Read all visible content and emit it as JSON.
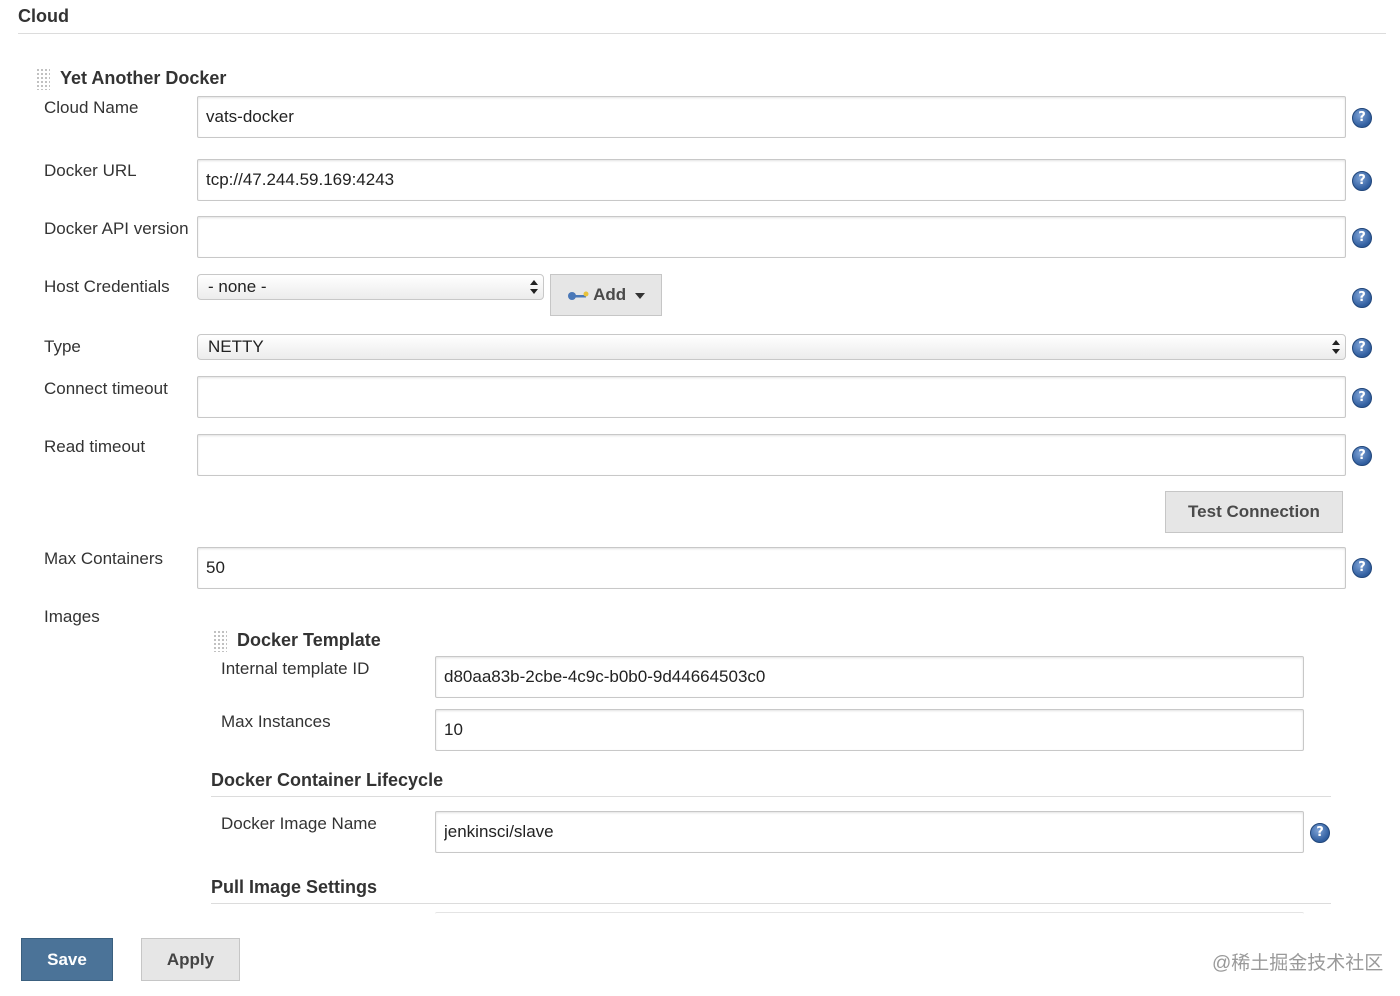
{
  "page": {
    "heading": "Cloud"
  },
  "cloud": {
    "title": "Yet Another Docker",
    "fields": {
      "cloud_name": {
        "label": "Cloud Name",
        "value": "vats-docker"
      },
      "docker_url": {
        "label": "Docker URL",
        "value": "tcp://47.244.59.169:4243"
      },
      "docker_api_version": {
        "label": "Docker API version",
        "value": ""
      },
      "host_credentials": {
        "label": "Host Credentials",
        "selected": "- none -",
        "add_label": "Add"
      },
      "type": {
        "label": "Type",
        "selected": "NETTY"
      },
      "connect_timeout": {
        "label": "Connect timeout",
        "value": ""
      },
      "read_timeout": {
        "label": "Read timeout",
        "value": ""
      },
      "max_containers": {
        "label": "Max Containers",
        "value": "50"
      }
    },
    "test_connection_label": "Test Connection",
    "images_label": "Images"
  },
  "template": {
    "title": "Docker Template",
    "internal_id": {
      "label": "Internal template ID",
      "value": "d80aa83b-2cbe-4c9c-b0b0-9d44664503c0"
    },
    "max_instances": {
      "label": "Max Instances",
      "value": "10"
    },
    "lifecycle_title": "Docker Container Lifecycle",
    "image_name": {
      "label": "Docker Image Name",
      "value": "jenkinsci/slave"
    },
    "pull_settings_title": "Pull Image Settings"
  },
  "footer": {
    "save_label": "Save",
    "apply_label": "Apply"
  },
  "watermark": "@稀土掘金技术社区",
  "colors": {
    "save_button": "#4b7398",
    "help_icon": "#2f5d9e"
  },
  "icons": {
    "help": "question-circle",
    "credentials": "key",
    "drag": "grip"
  }
}
